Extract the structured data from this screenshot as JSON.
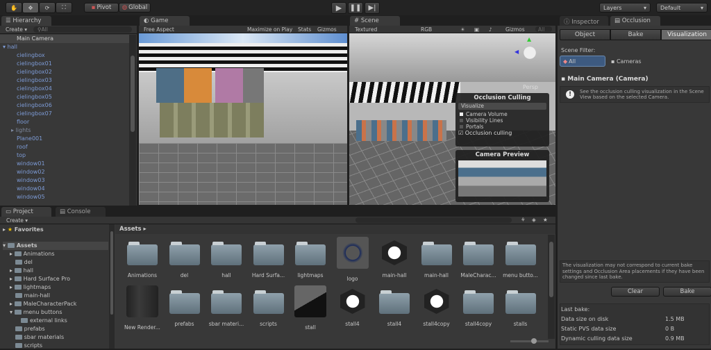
{
  "toolbar": {
    "tools": [
      "hand-tool",
      "move-tool",
      "rotate-tool",
      "scale-tool"
    ],
    "pivot": "Pivot",
    "global": "Global",
    "layers": "Layers",
    "layout": "Default"
  },
  "hierarchy": {
    "tab": "Hierarchy",
    "create": "Create",
    "search_placeholder": "All",
    "items": [
      {
        "label": "Main Camera",
        "level": 0,
        "selected": true
      },
      {
        "label": "hall",
        "level": 0,
        "expanded": true
      },
      {
        "label": "cielingbox",
        "level": 1
      },
      {
        "label": "cielingbox01",
        "level": 1
      },
      {
        "label": "cielingbox02",
        "level": 1
      },
      {
        "label": "cielingbox03",
        "level": 1
      },
      {
        "label": "cielingbox04",
        "level": 1
      },
      {
        "label": "cielingbox05",
        "level": 1
      },
      {
        "label": "cielingbox06",
        "level": 1
      },
      {
        "label": "cielingbox07",
        "level": 1
      },
      {
        "label": "floor",
        "level": 1
      },
      {
        "label": "lights",
        "level": 1,
        "collapsed": true
      },
      {
        "label": "Plane001",
        "level": 1
      },
      {
        "label": "roof",
        "level": 1
      },
      {
        "label": "top",
        "level": 1
      },
      {
        "label": "window01",
        "level": 1
      },
      {
        "label": "window02",
        "level": 1
      },
      {
        "label": "window03",
        "level": 1
      },
      {
        "label": "window04",
        "level": 1
      },
      {
        "label": "window05",
        "level": 1
      }
    ]
  },
  "game": {
    "tab": "Game",
    "aspect": "Free Aspect",
    "maximize": "Maximize on Play",
    "stats": "Stats",
    "gizmos": "Gizmos"
  },
  "scene": {
    "tab": "Scene",
    "shading": "Textured",
    "render_mode": "RGB",
    "gizmos": "Gizmos",
    "search_placeholder": "All",
    "persp": "Persp",
    "occlusion_panel": {
      "title": "Occlusion Culling",
      "mode": "Visualize",
      "options": [
        {
          "label": "Camera Volume",
          "checked": true
        },
        {
          "label": "Visibility Lines",
          "checked": false
        },
        {
          "label": "Portals",
          "checked": false
        }
      ],
      "occlusion_culling_label": "Occlusion culling",
      "occlusion_culling": true
    },
    "preview_title": "Camera Preview"
  },
  "inspector": {
    "tabs": [
      "Inspector",
      "Occlusion"
    ],
    "subtabs": [
      "Object",
      "Bake",
      "Visualization"
    ],
    "active_subtab": "Visualization",
    "scene_filter_label": "Scene Filter:",
    "filter_all": "All",
    "filter_cameras": "Cameras",
    "camera_title": "Main Camera (Camera)",
    "info": "See the occlusion culling visualization in the Scene View based on the selected Camera.",
    "warning": "The visualization may not correspond to current bake settings and Occlusion Area placements if they have been changed since last bake.",
    "clear": "Clear",
    "bake": "Bake",
    "last_bake": "Last bake:",
    "stats": [
      {
        "label": "Data size on disk",
        "value": "1.5 MB"
      },
      {
        "label": "Static PVS data size",
        "value": "0 B"
      },
      {
        "label": "Dynamic culling data size",
        "value": "0.9 MB"
      }
    ]
  },
  "project": {
    "tabs": [
      "Project",
      "Console"
    ],
    "create": "Create",
    "favorites": "Favorites",
    "assets_root": "Assets",
    "breadcrumb": "Assets",
    "tree": [
      {
        "label": "Animations",
        "arrow": true
      },
      {
        "label": "del"
      },
      {
        "label": "hall",
        "arrow": true
      },
      {
        "label": "Hard Surface Pro",
        "arrow": true
      },
      {
        "label": "lightmaps",
        "arrow": true
      },
      {
        "label": "main-hall"
      },
      {
        "label": "MaleCharacterPack",
        "arrow": true
      },
      {
        "label": "menu buttons",
        "expanded": true
      },
      {
        "label": "external links",
        "sub": true
      },
      {
        "label": "prefabs"
      },
      {
        "label": "sbar materials"
      },
      {
        "label": "scripts"
      }
    ],
    "assets": [
      {
        "label": "Animations",
        "type": "folder"
      },
      {
        "label": "del",
        "type": "folder"
      },
      {
        "label": "hall",
        "type": "folder"
      },
      {
        "label": "Hard Surfa...",
        "type": "folder"
      },
      {
        "label": "lightmaps",
        "type": "folder"
      },
      {
        "label": "logo",
        "type": "texture"
      },
      {
        "label": "main-hall",
        "type": "scene"
      },
      {
        "label": "main-hall",
        "type": "folder"
      },
      {
        "label": "MaleCharac...",
        "type": "folder"
      },
      {
        "label": "menu butto...",
        "type": "folder"
      },
      {
        "label": "New Render...",
        "type": "rendertexture"
      },
      {
        "label": "prefabs",
        "type": "folder"
      },
      {
        "label": "sbar materi...",
        "type": "folder"
      },
      {
        "label": "scripts",
        "type": "folder"
      },
      {
        "label": "stall",
        "type": "model"
      },
      {
        "label": "stall4",
        "type": "scene"
      },
      {
        "label": "stall4",
        "type": "folder"
      },
      {
        "label": "stall4copy",
        "type": "scene"
      },
      {
        "label": "stall4copy",
        "type": "folder"
      },
      {
        "label": "stalls",
        "type": "folder"
      }
    ]
  }
}
